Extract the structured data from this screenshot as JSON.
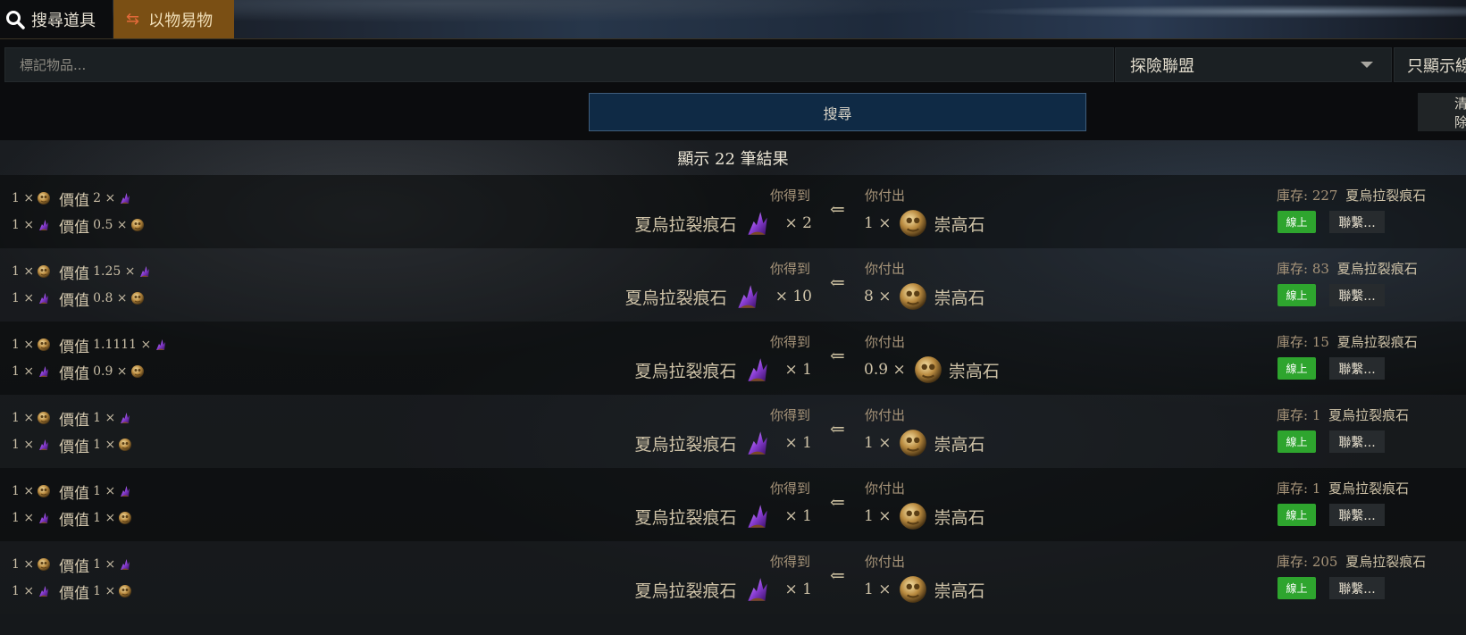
{
  "tabs": {
    "search": "搜尋道具",
    "exchange": "以物易物"
  },
  "filters": {
    "item_placeholder": "標記物品...",
    "league": "探險聯盟",
    "online_only": "只顯示線上"
  },
  "actions": {
    "search": "搜尋",
    "clear": "清除"
  },
  "results": {
    "count_text": "顯示 22 筆結果",
    "get_label": "你得到",
    "pay_label": "你付出",
    "stock_label": "庫存:",
    "status": "線上",
    "contact": "聯繫...",
    "rows": [
      {
        "r1_left": "1 ×",
        "r1_value": "價值",
        "r1_num": "2 ×",
        "r2_left": "1 ×",
        "r2_value": "價值",
        "r2_num": "0.5 ×",
        "get_item": "夏烏拉裂痕石",
        "get_qty": "× 2",
        "pay_qty": "1 ×",
        "pay_item": "崇高石",
        "stock_qty": "227",
        "stock_item": "夏烏拉裂痕石"
      },
      {
        "r1_left": "1 ×",
        "r1_value": "價值",
        "r1_num": "1.25 ×",
        "r2_left": "1 ×",
        "r2_value": "價值",
        "r2_num": "0.8 ×",
        "get_item": "夏烏拉裂痕石",
        "get_qty": "× 10",
        "pay_qty": "8 ×",
        "pay_item": "崇高石",
        "stock_qty": "83",
        "stock_item": "夏烏拉裂痕石"
      },
      {
        "r1_left": "1 ×",
        "r1_value": "價值",
        "r1_num": "1.1111 ×",
        "r2_left": "1 ×",
        "r2_value": "價值",
        "r2_num": "0.9 ×",
        "get_item": "夏烏拉裂痕石",
        "get_qty": "× 1",
        "pay_qty": "0.9 ×",
        "pay_item": "崇高石",
        "stock_qty": "15",
        "stock_item": "夏烏拉裂痕石"
      },
      {
        "r1_left": "1 ×",
        "r1_value": "價值",
        "r1_num": "1 ×",
        "r2_left": "1 ×",
        "r2_value": "價值",
        "r2_num": "1 ×",
        "get_item": "夏烏拉裂痕石",
        "get_qty": "× 1",
        "pay_qty": "1 ×",
        "pay_item": "崇高石",
        "stock_qty": "1",
        "stock_item": "夏烏拉裂痕石"
      },
      {
        "r1_left": "1 ×",
        "r1_value": "價值",
        "r1_num": "1 ×",
        "r2_left": "1 ×",
        "r2_value": "價值",
        "r2_num": "1 ×",
        "get_item": "夏烏拉裂痕石",
        "get_qty": "× 1",
        "pay_qty": "1 ×",
        "pay_item": "崇高石",
        "stock_qty": "1",
        "stock_item": "夏烏拉裂痕石"
      },
      {
        "r1_left": "1 ×",
        "r1_value": "價值",
        "r1_num": "1 ×",
        "r2_left": "1 ×",
        "r2_value": "價值",
        "r2_num": "1 ×",
        "get_item": "夏烏拉裂痕石",
        "get_qty": "× 1",
        "pay_qty": "1 ×",
        "pay_item": "崇高石",
        "stock_qty": "205",
        "stock_item": "夏烏拉裂痕石"
      }
    ]
  },
  "icons": {
    "search": "magnifier-icon",
    "exchange": "exchange-arrows-icon",
    "exalted": "exalted-orb-icon",
    "rift": "purple-rift-stone-icon",
    "arrow": "left-arrow-icon"
  },
  "colors": {
    "exchange_tab": "#7a4f14",
    "search_button": "#0f2a45",
    "online_badge": "#2ea52e"
  }
}
